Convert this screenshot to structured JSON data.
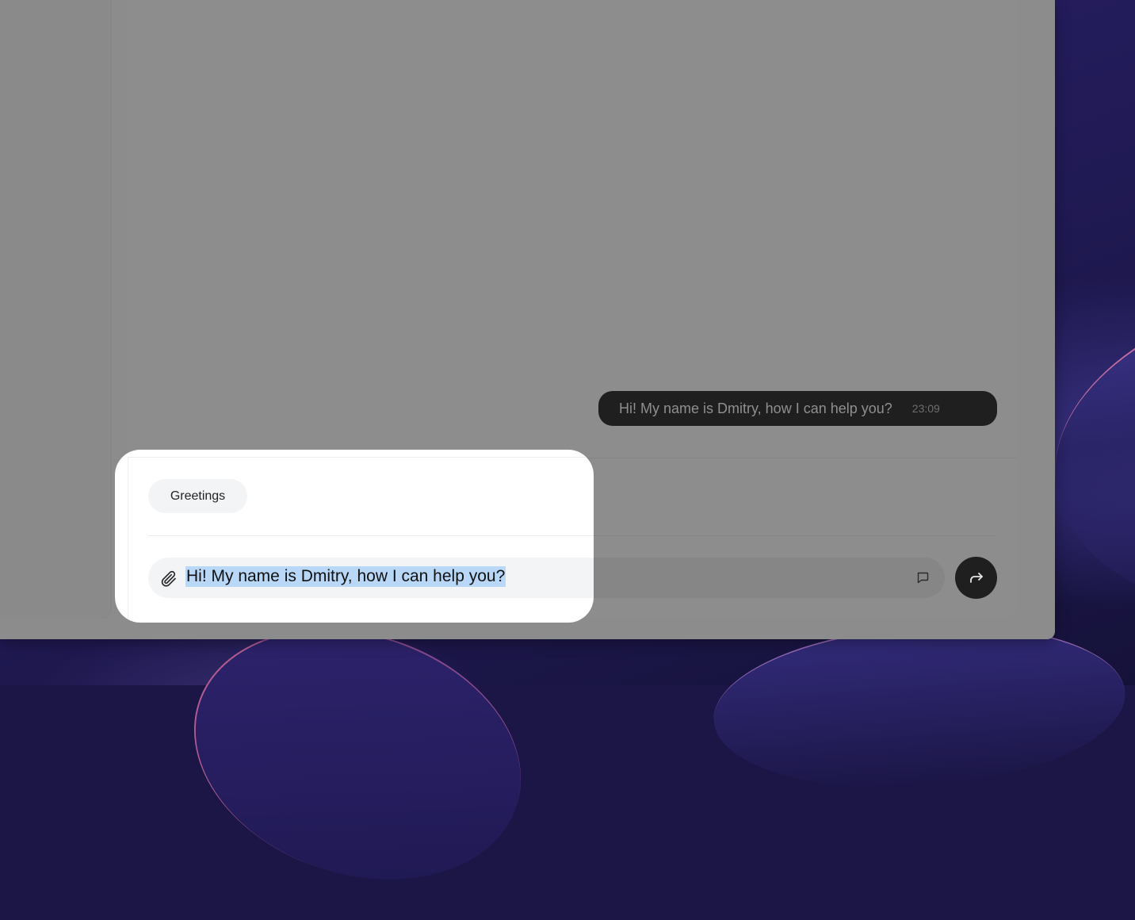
{
  "chat": {
    "messages": [
      {
        "text": "Hi! My name is Dmitry, how I can help you?",
        "time": "23:09"
      }
    ]
  },
  "quick_replies": [
    {
      "label": "Greetings"
    }
  ],
  "composer": {
    "value": "Hi! My name is Dmitry, how I can help you?",
    "value_selected": true
  },
  "icons": {
    "attach": "paperclip-icon",
    "template": "comment-icon",
    "send": "forward-arrow-icon"
  },
  "colors": {
    "overlay": "#8c8c8c",
    "bubble": "#1f1f1f",
    "selection": "#b9d8f8",
    "chip_bg": "#f3f4f6",
    "wallpaper": "#221b58"
  }
}
